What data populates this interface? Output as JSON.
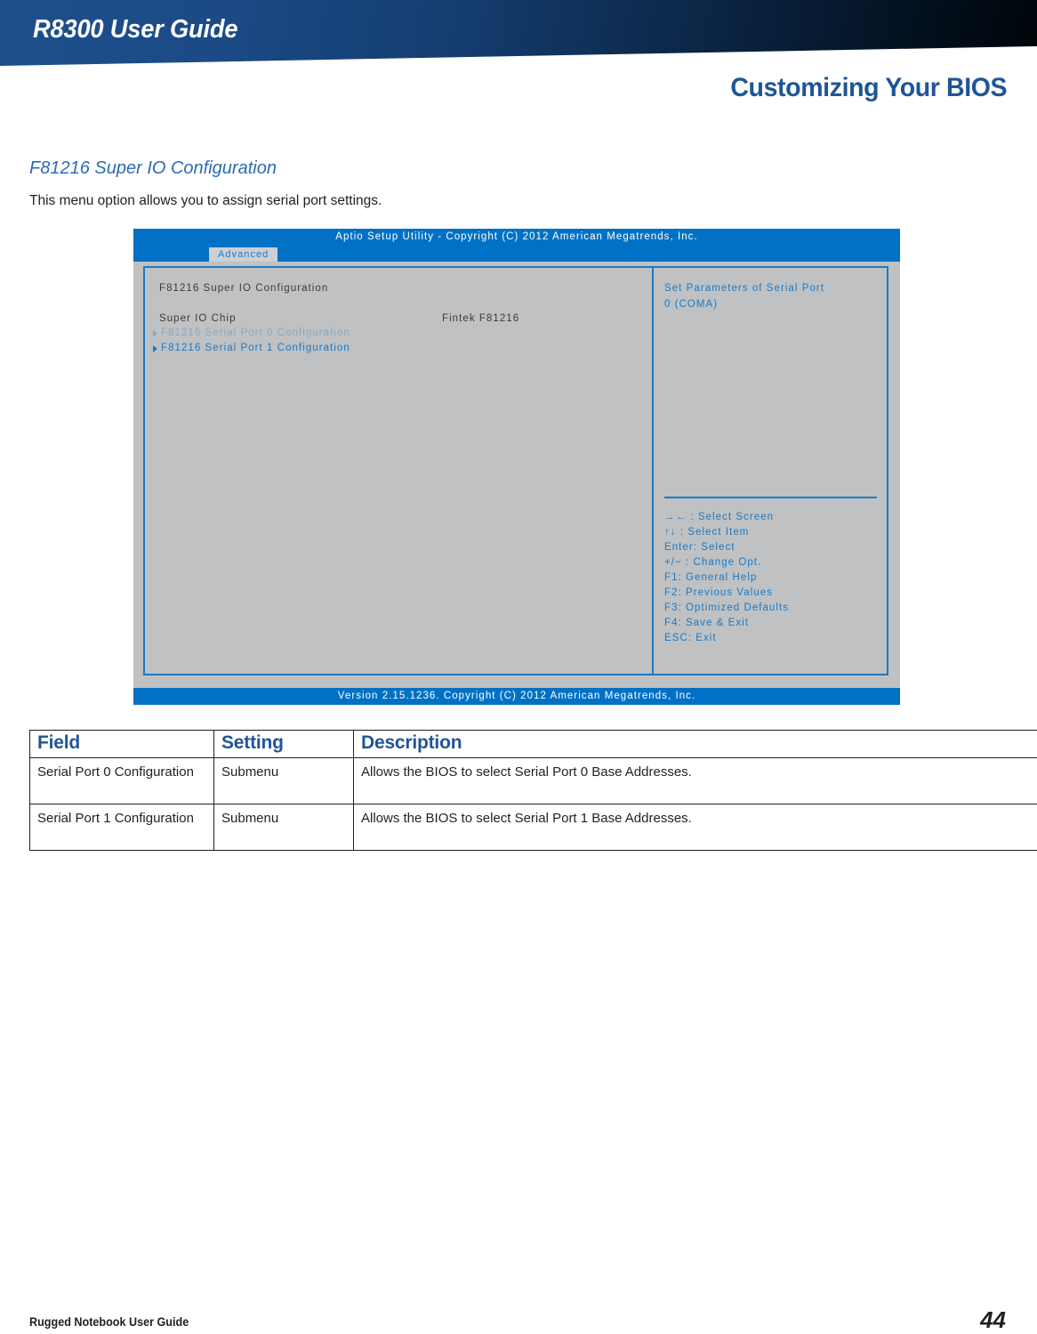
{
  "header": {
    "guide_title": "R8300 User Guide",
    "chapter_title": "Customizing Your BIOS",
    "banner_color": "#1b4a86",
    "chapter_color": "#1f5596"
  },
  "section": {
    "heading": "F81216 Super IO Configuration",
    "intro": "This menu option allows you to assign serial port settings."
  },
  "bios": {
    "title": "Aptio Setup Utility - Copyright (C) 2012 American Megatrends, Inc.",
    "active_tab": "Advanced",
    "version_bar": "Version 2.15.1236. Copyright (C) 2012 American Megatrends, Inc.",
    "accent_color": "#1b7ac4",
    "titlebar_color": "#0071c5",
    "body_color": "#bfc1c3",
    "left": {
      "section_title": "F81216 Super IO Configuration",
      "chip_label": "Super IO Chip",
      "chip_value": "Fintek F81216",
      "submenus": [
        {
          "label": "F81216 Serial Port 0 Configuration",
          "state": "normal"
        },
        {
          "label": "F81216 Serial Port 1 Configuration",
          "state": "selected"
        }
      ]
    },
    "help": {
      "line1": "Set Parameters of Serial Port",
      "line2": "0 (COMA)",
      "keys": [
        "→← : Select Screen",
        "↑↓ : Select Item",
        "Enter: Select",
        "+/− : Change Opt.",
        "F1: General Help",
        "F2: Previous Values",
        "F3: Optimized Defaults",
        "F4: Save & Exit",
        "ESC: Exit"
      ]
    }
  },
  "table": {
    "headers": [
      "Field",
      "Setting",
      "Description"
    ],
    "rows": [
      {
        "field": "Serial Port 0 Configuration",
        "setting": "Submenu",
        "description": "Allows the BIOS to select Serial Port 0 Base Addresses."
      },
      {
        "field": "Serial Port 1 Configuration",
        "setting": "Submenu",
        "description": "Allows the BIOS to select Serial Port 1 Base Addresses."
      }
    ]
  },
  "footer": {
    "label": "Rugged Notebook User Guide",
    "page_number": "44"
  }
}
